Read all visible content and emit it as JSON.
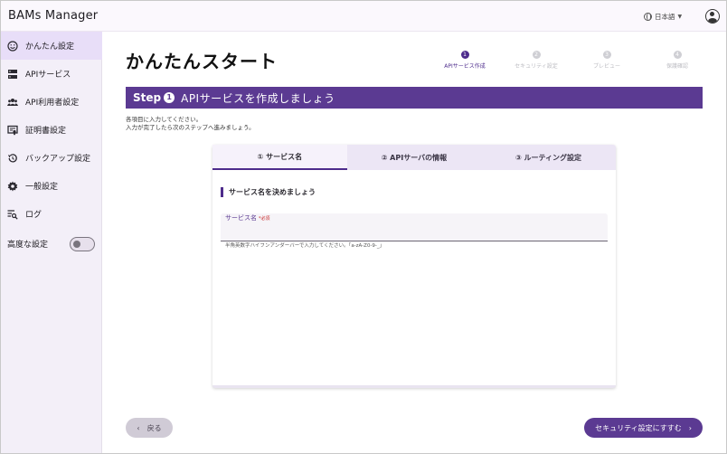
{
  "app": {
    "title": "BAMs Manager"
  },
  "header": {
    "language": "日本語"
  },
  "sidebar": {
    "items": [
      {
        "label": "かんたん設定",
        "icon": "smile-icon",
        "active": true
      },
      {
        "label": "APIサービス",
        "icon": "server-icon",
        "active": false
      },
      {
        "label": "API利用者設定",
        "icon": "users-icon",
        "active": false
      },
      {
        "label": "証明書設定",
        "icon": "certificate-icon",
        "active": false
      },
      {
        "label": "バックアップ設定",
        "icon": "backup-icon",
        "active": false
      },
      {
        "label": "一般設定",
        "icon": "gear-icon",
        "active": false
      },
      {
        "label": "ログ",
        "icon": "log-search-icon",
        "active": false
      }
    ],
    "advanced": {
      "label": "高度な設定",
      "enabled": false
    }
  },
  "main": {
    "title": "かんたんスタート",
    "stepper": [
      {
        "number": "1",
        "label": "APIサービス作成",
        "current": true
      },
      {
        "number": "2",
        "label": "セキュリティ設定",
        "current": false
      },
      {
        "number": "3",
        "label": "プレビュー",
        "current": false
      },
      {
        "number": "4",
        "label": "保護確認",
        "current": false
      }
    ],
    "step_banner": {
      "step_word": "Step",
      "step_number": "1",
      "heading": "APIサービスを作成しましょう"
    },
    "instructions": [
      "各項目に入力してください。",
      "入力が完了したら次のステップへ進みましょう。"
    ]
  },
  "card": {
    "tabs": [
      {
        "label": "① サービス名",
        "active": true
      },
      {
        "label": "② APIサーバの情報",
        "active": false
      },
      {
        "label": "③ ルーティング設定",
        "active": false
      }
    ],
    "section_title": "サービス名を決めましょう",
    "field": {
      "label": "サービス名",
      "required": "*必須",
      "value": "",
      "placeholder": ""
    },
    "helper": "半角英数字ハイフンアンダーバーで入力してください。「a-zA-Z0-9-_」"
  },
  "footer": {
    "back": {
      "label": "戻る",
      "arrow": "‹"
    },
    "next": {
      "label": "セキュリティ設定にすすむ",
      "arrow": "›"
    }
  },
  "colors": {
    "accent": "#5b3a92",
    "sidebar_bg": "#f3eff8",
    "active_nav": "#e8def8"
  }
}
